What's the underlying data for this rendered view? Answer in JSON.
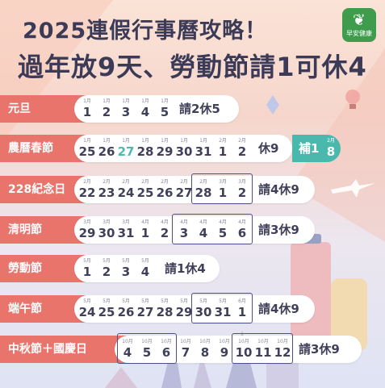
{
  "title_line1": "2025連假行事曆攻略！",
  "title_line2": "過年放9天、勞動節請1可休4",
  "logo": {
    "icon": "leaf-icon",
    "line1": "早安健康"
  },
  "colors": {
    "label": "#e8746c",
    "title": "#3b3a57",
    "teal": "#4bb8ad",
    "frame": "#4e5088"
  },
  "rows": [
    {
      "label": "元旦",
      "days": [
        {
          "m": "1月",
          "d": "1"
        },
        {
          "m": "1月",
          "d": "2"
        },
        {
          "m": "1月",
          "d": "3"
        },
        {
          "m": "1月",
          "d": "4"
        },
        {
          "m": "1月",
          "d": "5"
        }
      ],
      "result": "請2休5"
    },
    {
      "label": "農曆春節",
      "days": [
        {
          "m": "1月",
          "d": "25"
        },
        {
          "m": "1月",
          "d": "26"
        },
        {
          "m": "1月",
          "d": "27"
        },
        {
          "m": "1月",
          "d": "28"
        },
        {
          "m": "1月",
          "d": "29"
        },
        {
          "m": "1月",
          "d": "30"
        },
        {
          "m": "1月",
          "d": "31"
        },
        {
          "m": "2月",
          "d": "1"
        },
        {
          "m": "2月",
          "d": "2"
        }
      ],
      "result": "休9",
      "extra": {
        "label": "補1",
        "m": "2月",
        "d": "8"
      }
    },
    {
      "label": "228紀念日",
      "days": [
        {
          "m": "2月",
          "d": "22"
        },
        {
          "m": "2月",
          "d": "23"
        },
        {
          "m": "2月",
          "d": "24"
        },
        {
          "m": "2月",
          "d": "25"
        },
        {
          "m": "2月",
          "d": "26"
        },
        {
          "m": "2月",
          "d": "27"
        },
        {
          "m": "2月",
          "d": "28"
        },
        {
          "m": "3月",
          "d": "1"
        },
        {
          "m": "3月",
          "d": "2"
        }
      ],
      "result": "請4休9"
    },
    {
      "label": "清明節",
      "days": [
        {
          "m": "3月",
          "d": "29"
        },
        {
          "m": "3月",
          "d": "30"
        },
        {
          "m": "3月",
          "d": "31"
        },
        {
          "m": "4月",
          "d": "1"
        },
        {
          "m": "4月",
          "d": "2"
        },
        {
          "m": "4月",
          "d": "3"
        },
        {
          "m": "4月",
          "d": "4"
        },
        {
          "m": "4月",
          "d": "5"
        },
        {
          "m": "4月",
          "d": "6"
        }
      ],
      "result": "請3休9"
    },
    {
      "label": "勞動節",
      "days": [
        {
          "m": "5月",
          "d": "1"
        },
        {
          "m": "5月",
          "d": "2"
        },
        {
          "m": "5月",
          "d": "3"
        },
        {
          "m": "5月",
          "d": "4"
        }
      ],
      "result": "請1休4"
    },
    {
      "label": "端午節",
      "days": [
        {
          "m": "5月",
          "d": "24"
        },
        {
          "m": "5月",
          "d": "25"
        },
        {
          "m": "5月",
          "d": "26"
        },
        {
          "m": "5月",
          "d": "27"
        },
        {
          "m": "5月",
          "d": "28"
        },
        {
          "m": "5月",
          "d": "29"
        },
        {
          "m": "5月",
          "d": "30"
        },
        {
          "m": "5月",
          "d": "31"
        },
        {
          "m": "6月",
          "d": "1"
        }
      ],
      "result": "請4休9"
    },
    {
      "label": "中秋節＋國慶日",
      "days": [
        {
          "m": "10月",
          "d": "4"
        },
        {
          "m": "10月",
          "d": "5"
        },
        {
          "m": "10月",
          "d": "6"
        },
        {
          "m": "10月",
          "d": "7"
        },
        {
          "m": "10月",
          "d": "8"
        },
        {
          "m": "10月",
          "d": "9"
        },
        {
          "m": "10月",
          "d": "10"
        },
        {
          "m": "10月",
          "d": "11"
        },
        {
          "m": "10月",
          "d": "12"
        }
      ],
      "result": "請3休9"
    }
  ]
}
